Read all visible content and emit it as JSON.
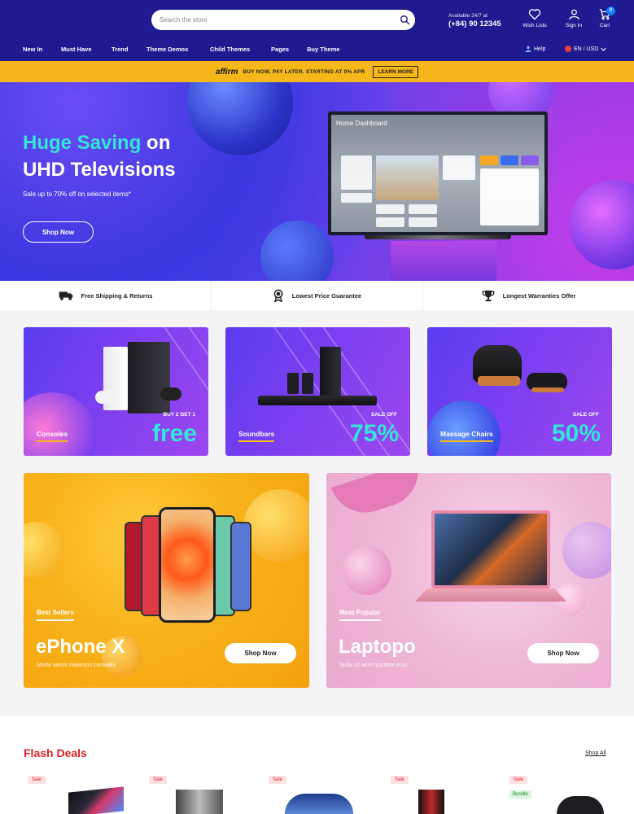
{
  "header": {
    "search_placeholder": "Search the store",
    "support_line1": "Available 24/7 at",
    "support_phone": "(+84) 90 12345",
    "wishlist_label": "Wish Lists",
    "signin_label": "Sign In",
    "cart_label": "Cart",
    "cart_count": "0",
    "nav": [
      "New In",
      "Must Have",
      "Trend",
      "Theme Demos",
      "Child Themes",
      "Pages",
      "Buy Theme"
    ],
    "help_label": "Help",
    "currency_label": "EN / USD"
  },
  "affirm": {
    "logo": "affirm",
    "text": "BUY NOW, PAY LATER. STARTING AT 0% APR",
    "button": "LEARN MORE"
  },
  "hero": {
    "title_highlight": "Huge Saving",
    "title_rest1": " on",
    "title_line2": "UHD Televisions",
    "subtitle": "Sale up to 70% off on selected items*",
    "button": "Shop Now",
    "tv_title": "Home Dashboard"
  },
  "features": [
    {
      "label": "Free Shipping & Returns",
      "icon": "truck-icon"
    },
    {
      "label": "Lowest Price Guarantee",
      "icon": "award-icon"
    },
    {
      "label": "Longest Warranties Offer",
      "icon": "trophy-icon"
    }
  ],
  "promos": [
    {
      "name": "Consoles",
      "offer": "BUY 2 GET 1",
      "big": "free"
    },
    {
      "name": "Soundbars",
      "offer": "SALE OFF",
      "big": "75%"
    },
    {
      "name": "Massage Chairs",
      "offer": "SALE OFF",
      "big": "50%"
    }
  ],
  "banners": [
    {
      "tag": "Best Sellers",
      "title": "ePhone X",
      "desc": "Morbi varius maximus convallis",
      "button": "Shop Now"
    },
    {
      "tag": "Most Popular",
      "title": "Laptopo",
      "desc": "Nulla sit amet porttitor eros",
      "button": "Shop Now"
    }
  ],
  "flash": {
    "title": "Flash Deals",
    "shop_all": "Shop All",
    "sale_tag": "Sale",
    "bundle_tag": "Bundle"
  },
  "colors": {
    "header_bg": "#1f1a8f",
    "affirm_bg": "#f6b71a",
    "accent_teal": "#33e6d8",
    "flash_red": "#e01f26"
  }
}
